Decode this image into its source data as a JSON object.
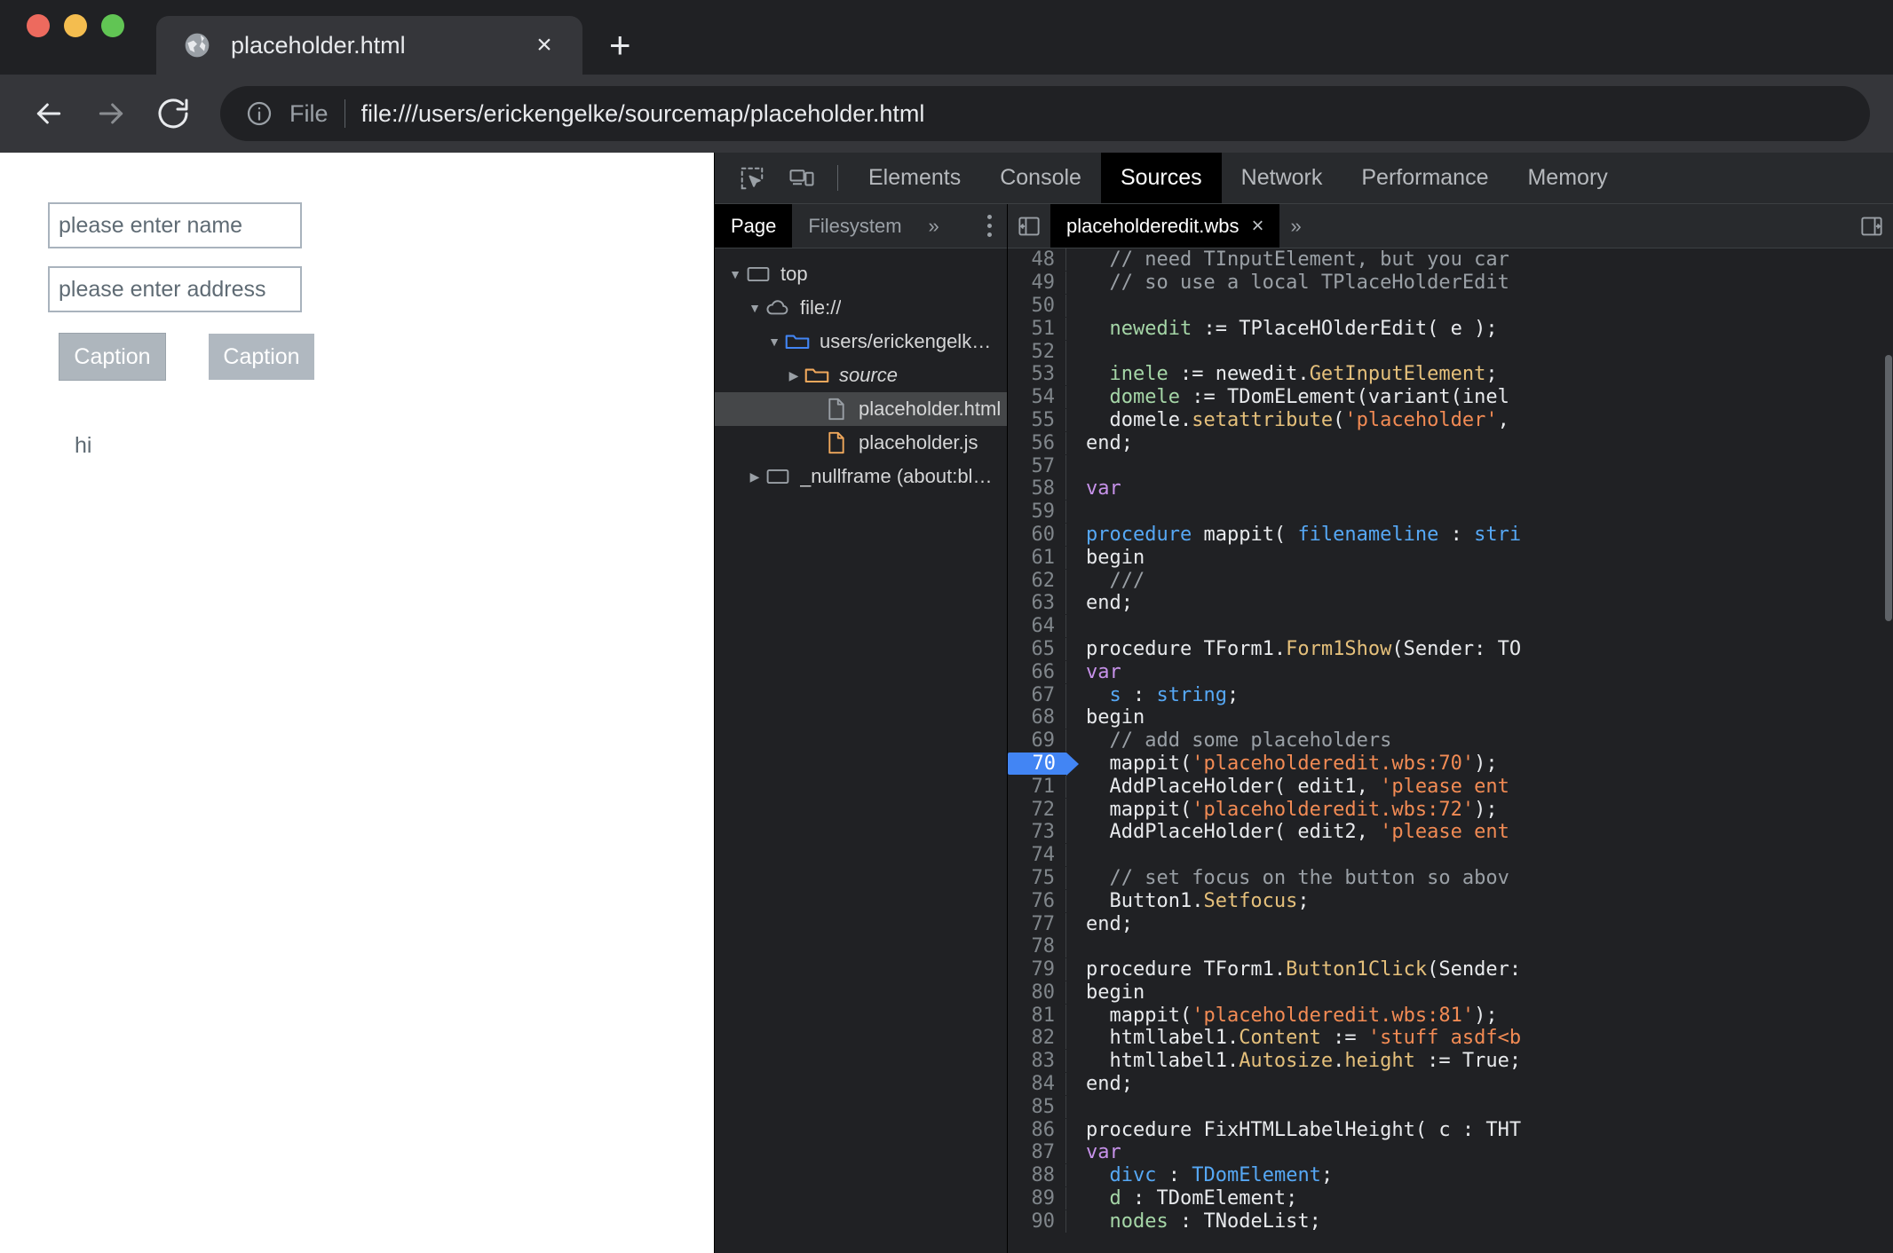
{
  "browser": {
    "window_controls": [
      "close",
      "minimize",
      "maximize"
    ],
    "tab": {
      "title": "placeholder.html",
      "favicon": "globe-icon",
      "close_label": "×"
    },
    "new_tab_label": "+",
    "toolbar": {
      "back_label": "←",
      "forward_label": "→",
      "reload_label": "↻",
      "scheme_label": "File",
      "url": "file:///users/erickengelke/sourcemap/placeholder.html",
      "info_icon": "info-circle-icon"
    }
  },
  "page": {
    "inputs": [
      {
        "placeholder": "please enter name",
        "value": ""
      },
      {
        "placeholder": "please enter address",
        "value": ""
      }
    ],
    "buttons": [
      {
        "label": "Caption",
        "focused": true
      },
      {
        "label": "Caption",
        "focused": false
      }
    ],
    "label": "hi"
  },
  "devtools": {
    "toolbar_icons": [
      "inspect-element-icon",
      "device-toolbar-icon"
    ],
    "tabs": [
      {
        "label": "Elements",
        "active": false
      },
      {
        "label": "Console",
        "active": false
      },
      {
        "label": "Sources",
        "active": true
      },
      {
        "label": "Network",
        "active": false
      },
      {
        "label": "Performance",
        "active": false
      },
      {
        "label": "Memory",
        "active": false
      }
    ],
    "navigator": {
      "subtabs": [
        {
          "label": "Page",
          "active": true
        },
        {
          "label": "Filesystem",
          "active": false
        }
      ],
      "more_label": "»",
      "menu_icon": "kebab-menu-icon",
      "tree": [
        {
          "label": "top",
          "icon": "frame-icon",
          "twisty": "▼",
          "indent": 0,
          "selected": false,
          "italic": false
        },
        {
          "label": "file://",
          "icon": "cloud-icon",
          "twisty": "▼",
          "indent": 1,
          "selected": false,
          "italic": false
        },
        {
          "label": "users/erickengelke/sourcemap",
          "icon": "folder-blue-icon",
          "twisty": "▼",
          "indent": 2,
          "selected": false,
          "italic": false
        },
        {
          "label": "source",
          "icon": "folder-orange-icon",
          "twisty": "▶",
          "indent": 3,
          "selected": false,
          "italic": true
        },
        {
          "label": "placeholder.html",
          "icon": "file-gray-icon",
          "twisty": "",
          "indent": 4,
          "selected": true,
          "italic": false
        },
        {
          "label": "placeholder.js",
          "icon": "file-orange-icon",
          "twisty": "",
          "indent": 4,
          "selected": false,
          "italic": false
        },
        {
          "label": "_nullframe (about:blank)",
          "icon": "frame-icon",
          "twisty": "▶",
          "indent": 1,
          "selected": false,
          "italic": false
        }
      ]
    },
    "editor": {
      "collapse_left_icon": "panel-collapse-left-icon",
      "expand_right_icon": "panel-expand-right-icon",
      "more_label": "»",
      "open_tab": {
        "label": "placeholderedit.wbs",
        "close_label": "×",
        "active": true
      },
      "breakpoint_line": 70,
      "first_visible_line": 48,
      "lines": [
        {
          "n": 48,
          "tokens": [
            {
              "t": "  // need TInputElement, but you car",
              "c": "c-com"
            }
          ]
        },
        {
          "n": 49,
          "tokens": [
            {
              "t": "  // so use a local TPlaceHolderEdit",
              "c": "c-com"
            }
          ]
        },
        {
          "n": 50,
          "tokens": []
        },
        {
          "n": 51,
          "tokens": [
            {
              "t": "  ",
              "c": "c-pl"
            },
            {
              "t": "newedit",
              "c": "c-id"
            },
            {
              "t": " := TPlaceHOlderEdit( e );",
              "c": "c-pl"
            }
          ]
        },
        {
          "n": 52,
          "tokens": []
        },
        {
          "n": 53,
          "tokens": [
            {
              "t": "  ",
              "c": "c-pl"
            },
            {
              "t": "inele",
              "c": "c-id"
            },
            {
              "t": " := newedit.",
              "c": "c-pl"
            },
            {
              "t": "GetInputElement",
              "c": "c-fn"
            },
            {
              "t": ";",
              "c": "c-pl"
            }
          ]
        },
        {
          "n": 54,
          "tokens": [
            {
              "t": "  ",
              "c": "c-pl"
            },
            {
              "t": "domele",
              "c": "c-id"
            },
            {
              "t": " := TDomELement(variant(inel",
              "c": "c-pl"
            }
          ]
        },
        {
          "n": 55,
          "tokens": [
            {
              "t": "  domele.",
              "c": "c-pl"
            },
            {
              "t": "setattribute",
              "c": "c-fn"
            },
            {
              "t": "(",
              "c": "c-pl"
            },
            {
              "t": "'placeholder'",
              "c": "c-str"
            },
            {
              "t": ",",
              "c": "c-pl"
            }
          ]
        },
        {
          "n": 56,
          "tokens": [
            {
              "t": "end;",
              "c": "c-pl"
            }
          ]
        },
        {
          "n": 57,
          "tokens": []
        },
        {
          "n": 58,
          "tokens": [
            {
              "t": "var",
              "c": "c-kw"
            }
          ]
        },
        {
          "n": 59,
          "tokens": []
        },
        {
          "n": 60,
          "tokens": [
            {
              "t": "procedure",
              "c": "c-kw2"
            },
            {
              "t": " mappit( ",
              "c": "c-pl"
            },
            {
              "t": "filenameline",
              "c": "c-kw2"
            },
            {
              "t": " : ",
              "c": "c-pl"
            },
            {
              "t": "stri",
              "c": "c-kw2"
            }
          ]
        },
        {
          "n": 61,
          "tokens": [
            {
              "t": "begin",
              "c": "c-pl"
            }
          ]
        },
        {
          "n": 62,
          "tokens": [
            {
              "t": "  ///",
              "c": "c-com"
            }
          ]
        },
        {
          "n": 63,
          "tokens": [
            {
              "t": "end;",
              "c": "c-pl"
            }
          ]
        },
        {
          "n": 64,
          "tokens": []
        },
        {
          "n": 65,
          "tokens": [
            {
              "t": "procedure TForm1.",
              "c": "c-pl"
            },
            {
              "t": "Form1Show",
              "c": "c-fn"
            },
            {
              "t": "(Sender: TO",
              "c": "c-pl"
            }
          ]
        },
        {
          "n": 66,
          "tokens": [
            {
              "t": "var",
              "c": "c-kw"
            }
          ]
        },
        {
          "n": 67,
          "tokens": [
            {
              "t": "  ",
              "c": "c-pl"
            },
            {
              "t": "s",
              "c": "c-kw2"
            },
            {
              "t": " : ",
              "c": "c-pl"
            },
            {
              "t": "string",
              "c": "c-kw2"
            },
            {
              "t": ";",
              "c": "c-pl"
            }
          ]
        },
        {
          "n": 68,
          "tokens": [
            {
              "t": "begin",
              "c": "c-pl"
            }
          ]
        },
        {
          "n": 69,
          "tokens": [
            {
              "t": "  // add some placeholders",
              "c": "c-com"
            }
          ]
        },
        {
          "n": 70,
          "tokens": [
            {
              "t": "  mappit(",
              "c": "c-pl"
            },
            {
              "t": "'placeholderedit.wbs:70'",
              "c": "c-str"
            },
            {
              "t": ");",
              "c": "c-pl"
            }
          ]
        },
        {
          "n": 71,
          "tokens": [
            {
              "t": "  AddPlaceHolder( edit1, ",
              "c": "c-pl"
            },
            {
              "t": "'please ent",
              "c": "c-str"
            }
          ]
        },
        {
          "n": 72,
          "tokens": [
            {
              "t": "  mappit(",
              "c": "c-pl"
            },
            {
              "t": "'placeholderedit.wbs:72'",
              "c": "c-str"
            },
            {
              "t": ");",
              "c": "c-pl"
            }
          ]
        },
        {
          "n": 73,
          "tokens": [
            {
              "t": "  AddPlaceHolder( edit2, ",
              "c": "c-pl"
            },
            {
              "t": "'please ent",
              "c": "c-str"
            }
          ]
        },
        {
          "n": 74,
          "tokens": []
        },
        {
          "n": 75,
          "tokens": [
            {
              "t": "  // set focus on the button so abov",
              "c": "c-com"
            }
          ]
        },
        {
          "n": 76,
          "tokens": [
            {
              "t": "  Button1.",
              "c": "c-pl"
            },
            {
              "t": "Setfocus",
              "c": "c-fn"
            },
            {
              "t": ";",
              "c": "c-pl"
            }
          ]
        },
        {
          "n": 77,
          "tokens": [
            {
              "t": "end;",
              "c": "c-pl"
            }
          ]
        },
        {
          "n": 78,
          "tokens": []
        },
        {
          "n": 79,
          "tokens": [
            {
              "t": "procedure TForm1.",
              "c": "c-pl"
            },
            {
              "t": "Button1Click",
              "c": "c-fn"
            },
            {
              "t": "(Sender:",
              "c": "c-pl"
            }
          ]
        },
        {
          "n": 80,
          "tokens": [
            {
              "t": "begin",
              "c": "c-pl"
            }
          ]
        },
        {
          "n": 81,
          "tokens": [
            {
              "t": "  mappit(",
              "c": "c-pl"
            },
            {
              "t": "'placeholderedit.wbs:81'",
              "c": "c-str"
            },
            {
              "t": ");",
              "c": "c-pl"
            }
          ]
        },
        {
          "n": 82,
          "tokens": [
            {
              "t": "  htmllabel1.",
              "c": "c-pl"
            },
            {
              "t": "Content",
              "c": "c-fn"
            },
            {
              "t": " := ",
              "c": "c-pl"
            },
            {
              "t": "'stuff asdf<b",
              "c": "c-str"
            }
          ]
        },
        {
          "n": 83,
          "tokens": [
            {
              "t": "  htmllabel1.",
              "c": "c-pl"
            },
            {
              "t": "Autosize",
              "c": "c-fn"
            },
            {
              "t": ".",
              "c": "c-pl"
            },
            {
              "t": "height",
              "c": "c-fn"
            },
            {
              "t": " := True;",
              "c": "c-pl"
            }
          ]
        },
        {
          "n": 84,
          "tokens": [
            {
              "t": "end;",
              "c": "c-pl"
            }
          ]
        },
        {
          "n": 85,
          "tokens": []
        },
        {
          "n": 86,
          "tokens": [
            {
              "t": "procedure FixHTMLLabelHeight( c : THT",
              "c": "c-pl"
            }
          ]
        },
        {
          "n": 87,
          "tokens": [
            {
              "t": "var",
              "c": "c-kw"
            }
          ]
        },
        {
          "n": 88,
          "tokens": [
            {
              "t": "  ",
              "c": "c-pl"
            },
            {
              "t": "divc",
              "c": "c-kw2"
            },
            {
              "t": " : ",
              "c": "c-pl"
            },
            {
              "t": "TDomElement",
              "c": "c-kw2"
            },
            {
              "t": ";",
              "c": "c-pl"
            }
          ]
        },
        {
          "n": 89,
          "tokens": [
            {
              "t": "  ",
              "c": "c-pl"
            },
            {
              "t": "d",
              "c": "c-id"
            },
            {
              "t": " : TDomElement;",
              "c": "c-pl"
            }
          ]
        },
        {
          "n": 90,
          "tokens": [
            {
              "t": "  ",
              "c": "c-pl"
            },
            {
              "t": "nodes",
              "c": "c-id"
            },
            {
              "t": " : TNodeList;",
              "c": "c-pl"
            }
          ]
        }
      ]
    }
  },
  "colors": {
    "accent_blue": "#4285f4",
    "devtools_bg": "#202124",
    "devtools_panel": "#282a2d",
    "string_orange": "#f28b54",
    "keyword_purple": "#c792ea",
    "method_yellow": "#e5c07b"
  }
}
